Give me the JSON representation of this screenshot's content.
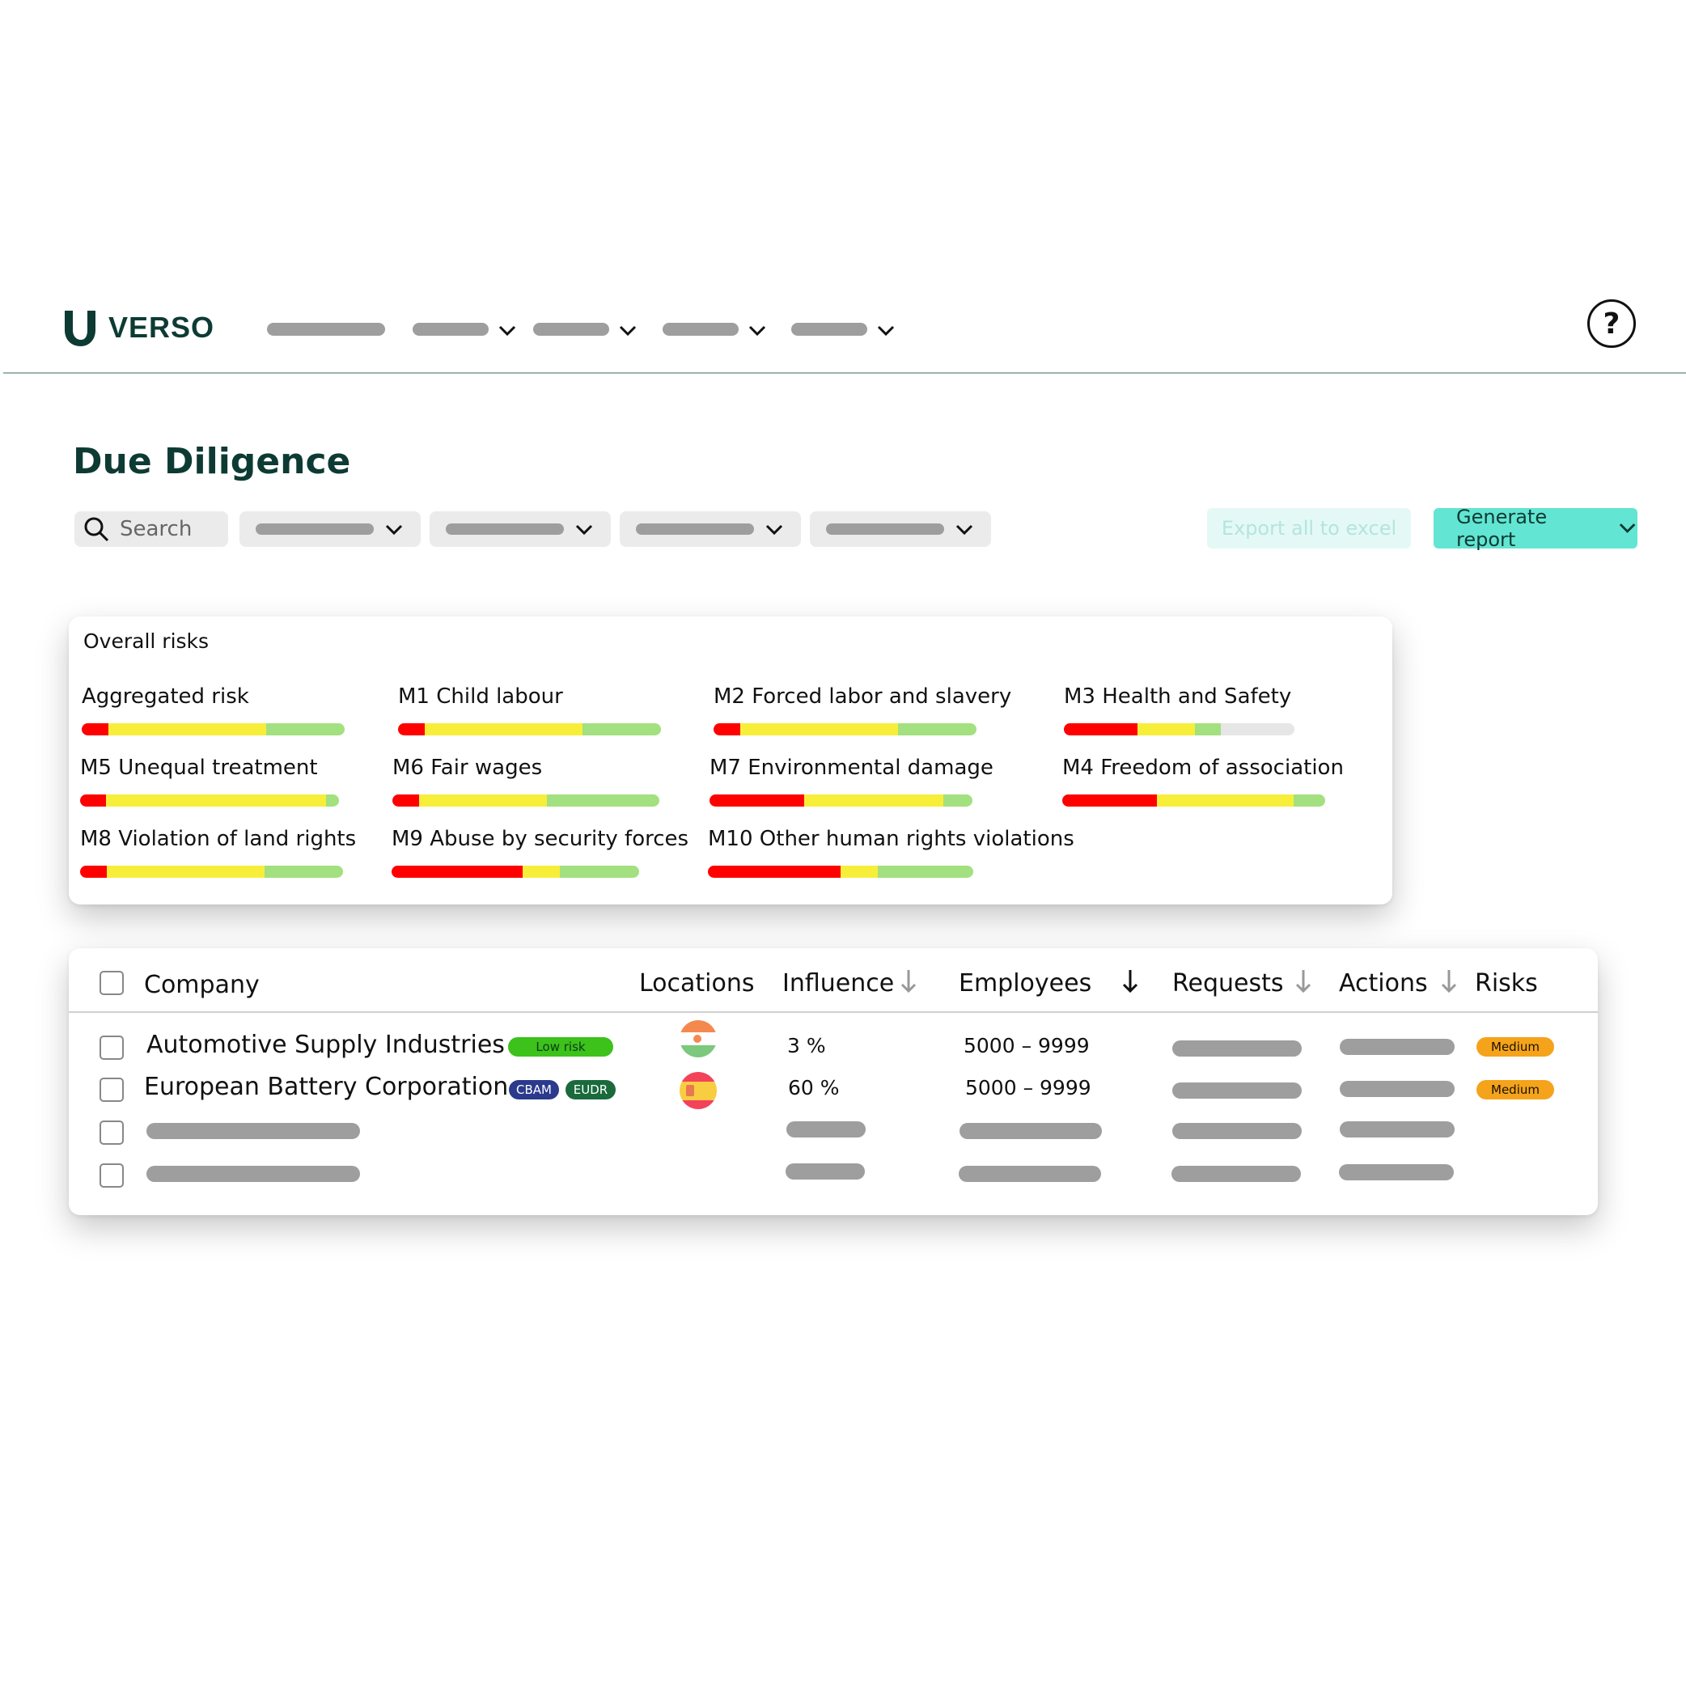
{
  "header": {
    "brand": "VERSO",
    "help_label": "?"
  },
  "page": {
    "title": "Due Diligence"
  },
  "toolbar": {
    "search_placeholder": "Search",
    "export_label": "Export all to excel",
    "generate_label": "Generate report"
  },
  "overall_risks": {
    "title": "Overall risks",
    "items": [
      {
        "label": "Aggregated risk",
        "high": 0.1,
        "medium": 0.6,
        "low": 0.3,
        "none": 0
      },
      {
        "label": "M1 Child labour",
        "high": 0.1,
        "medium": 0.6,
        "low": 0.3,
        "none": 0
      },
      {
        "label": "M2 Forced labor and slavery",
        "high": 0.1,
        "medium": 0.6,
        "low": 0.3,
        "none": 0
      },
      {
        "label": "M3 Health and Safety",
        "high": 0.32,
        "medium": 0.25,
        "low": 0.11,
        "none": 0.32
      },
      {
        "label": "M5 Unequal treatment",
        "high": 0.1,
        "medium": 0.85,
        "low": 0.05,
        "none": 0
      },
      {
        "label": "M6 Fair wages",
        "high": 0.1,
        "medium": 0.48,
        "low": 0.42,
        "none": 0
      },
      {
        "label": "M7 Environmental damage",
        "high": 0.36,
        "medium": 0.53,
        "low": 0.11,
        "none": 0
      },
      {
        "label": "M4 Freedom of association",
        "high": 0.36,
        "medium": 0.52,
        "low": 0.12,
        "none": 0
      },
      {
        "label": "M8 Violation of land rights",
        "high": 0.1,
        "medium": 0.6,
        "low": 0.3,
        "none": 0
      },
      {
        "label": "M9 Abuse by security forces",
        "high": 0.53,
        "medium": 0.15,
        "low": 0.32,
        "none": 0
      },
      {
        "label": "M10 Other human rights violations",
        "high": 0.5,
        "medium": 0.14,
        "low": 0.36,
        "none": 0
      }
    ]
  },
  "table": {
    "columns": {
      "company": "Company",
      "locations": "Locations",
      "influence": "Influence",
      "employees": "Employees",
      "requests": "Requests",
      "actions": "Actions",
      "risks": "Risks"
    },
    "rows": [
      {
        "company": "Automotive Supply Industries",
        "tags": [
          "Low risk"
        ],
        "influence": "3 %",
        "employees": "5000 – 9999",
        "risk": "Medium"
      },
      {
        "company": "European Battery Corporation",
        "tags": [
          "CBAM",
          "EUDR"
        ],
        "influence": "60 %",
        "employees": "5000 – 9999",
        "risk": "Medium"
      }
    ]
  },
  "colors": {
    "brand": "#0d3b34",
    "accent": "#62e5d2",
    "risk_high": "#ff0000",
    "risk_medium": "#f7ee3a",
    "risk_low": "#a3e07f",
    "badge_medium": "#f5a31b"
  },
  "icons": [
    "verso-logo-icon",
    "chevron-down-icon",
    "help-icon",
    "search-icon",
    "sort-arrow-down-icon",
    "checkbox-icon",
    "flag-india-icon",
    "flag-spain-icon"
  ]
}
